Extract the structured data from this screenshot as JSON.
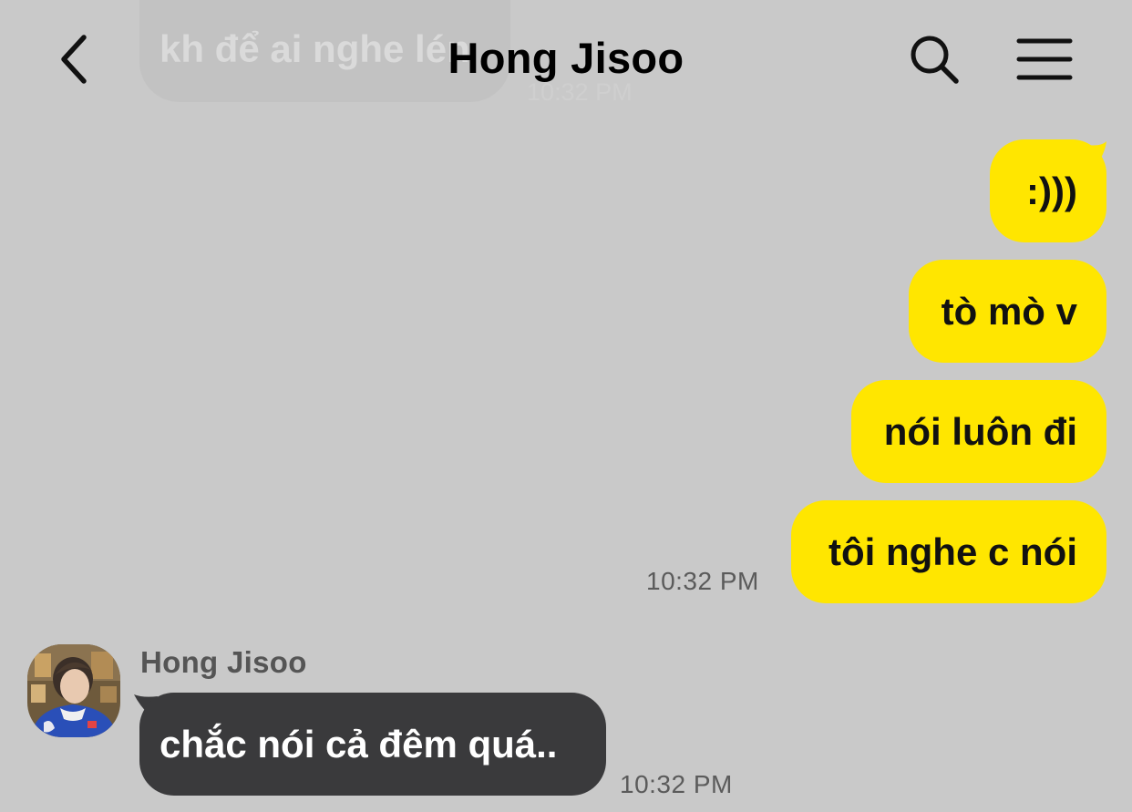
{
  "header": {
    "title": "Hong Jisoo",
    "back_icon": "chevron-left-icon",
    "search_icon": "search-icon",
    "menu_icon": "hamburger-menu-icon"
  },
  "faded_message": {
    "text": "kh để ai nghe lén",
    "time": "10:32 PM"
  },
  "outgoing": {
    "messages": [
      ":)))",
      "tò mò v",
      "nói luôn đi",
      "tôi nghe c nói"
    ],
    "time": "10:32 PM",
    "bubble_color": "#ffe600"
  },
  "incoming": {
    "sender": "Hong Jisoo",
    "message": "chắc nói cả đêm quá..",
    "time": "10:32 PM",
    "bubble_color": "#3a3a3c"
  },
  "colors": {
    "background": "#c9c9c9"
  }
}
